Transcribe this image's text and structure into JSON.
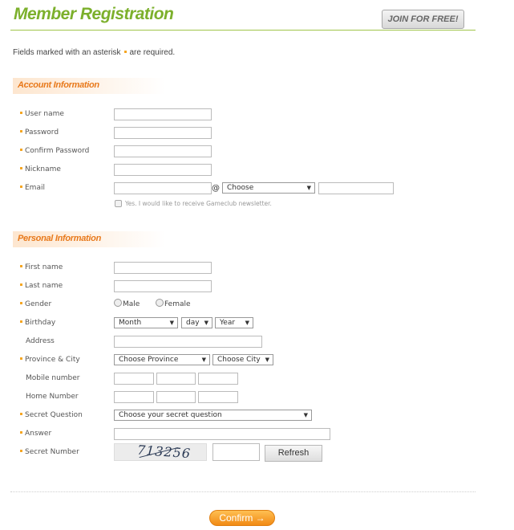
{
  "header": {
    "title": "Member Registration",
    "join_button": "JOIN FOR FREE!"
  },
  "required_note": {
    "before": "Fields marked with an asterisk",
    "after": "are required."
  },
  "sections": {
    "account": "Account Information",
    "personal": "Personal Information"
  },
  "account": {
    "username_label": "User name",
    "password_label": "Password",
    "confirm_password_label": "Confirm Password",
    "nickname_label": "Nickname",
    "email_label": "Email",
    "email_at": "@",
    "email_domain_select": "Choose",
    "newsletter_label": "Yes. I would like to receive Gameclub newsletter."
  },
  "personal": {
    "first_name_label": "First name",
    "last_name_label": "Last name",
    "gender_label": "Gender",
    "gender_male": "Male",
    "gender_female": "Female",
    "birthday_label": "Birthday",
    "birthday_month": "Month",
    "birthday_day": "day",
    "birthday_year": "Year",
    "address_label": "Address",
    "province_city_label": "Province & City",
    "province_select": "Choose Province",
    "city_select": "Choose City",
    "mobile_label": "Mobile number",
    "home_label": "Home Number",
    "secret_question_label": "Secret Question",
    "secret_question_select": "Choose your secret question",
    "answer_label": "Answer",
    "secret_number_label": "Secret Number",
    "captcha_text": "713256",
    "refresh_button": "Refresh"
  },
  "footer": {
    "confirm_button": "Confirm →"
  },
  "colors": {
    "brand_green": "#7cb02c",
    "section_orange": "#e8791b",
    "asterisk": "#f5a623"
  }
}
